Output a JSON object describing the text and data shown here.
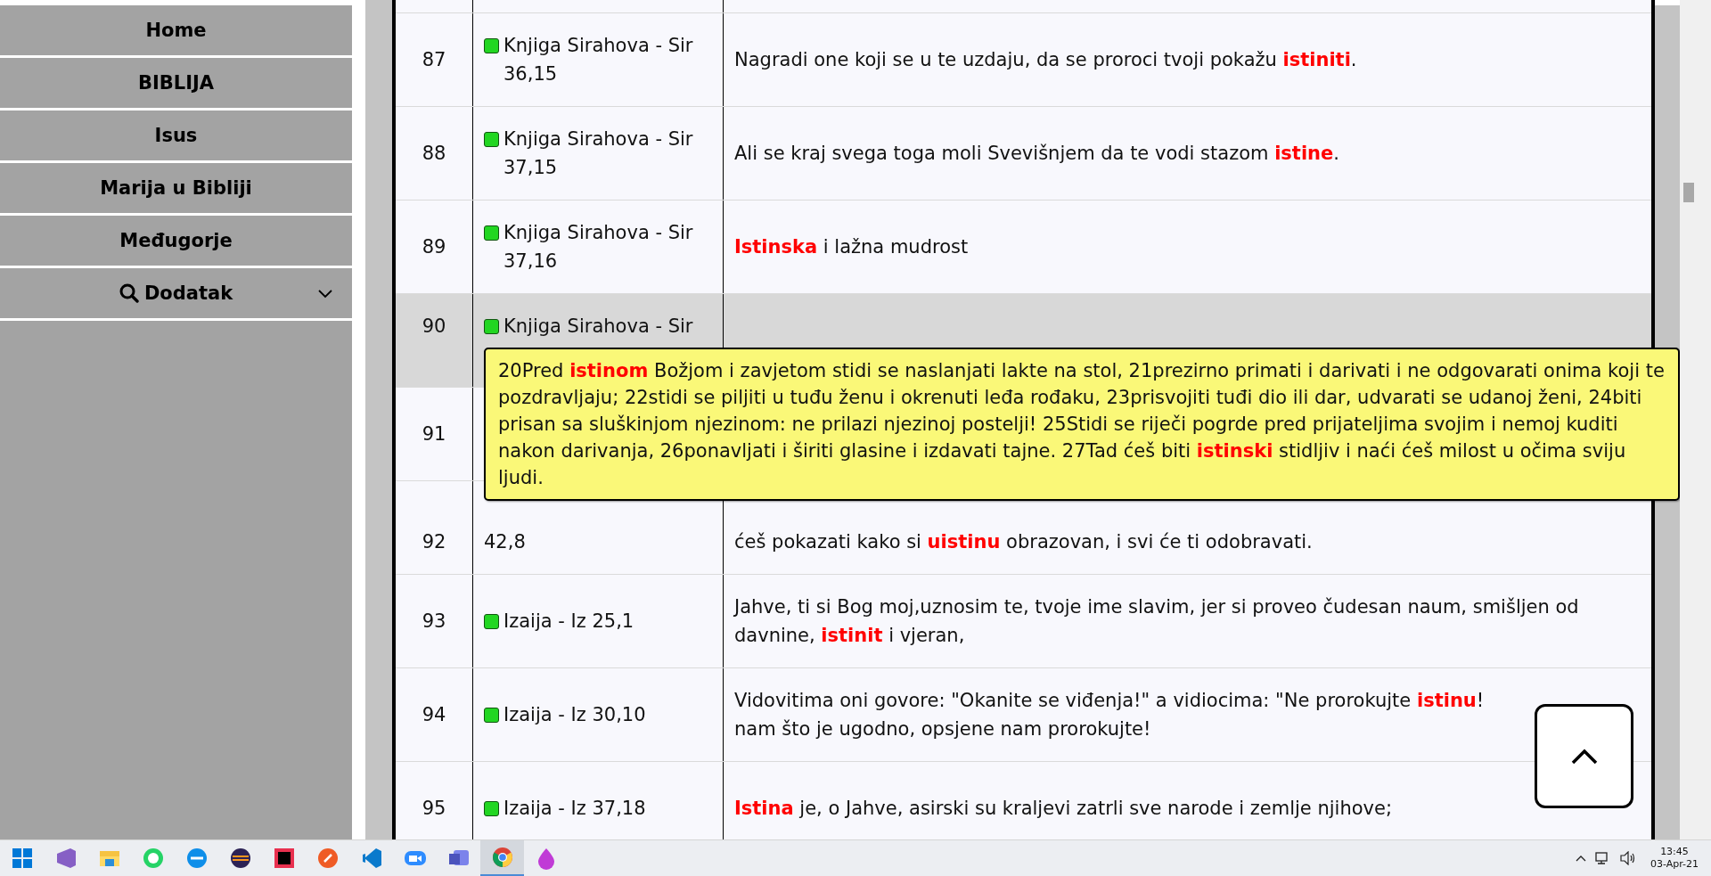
{
  "sidebar": {
    "items": [
      {
        "label": "Home",
        "kind": "link"
      },
      {
        "label": "BIBLIJA",
        "kind": "link"
      },
      {
        "label": "Isus",
        "kind": "link"
      },
      {
        "label": "Marija u Bibliji",
        "kind": "link"
      },
      {
        "label": "Međugorje",
        "kind": "link"
      },
      {
        "label": "Dodatak",
        "kind": "dropdown",
        "expanded": false
      }
    ]
  },
  "table": {
    "rows": [
      {
        "number": "87",
        "reference": "Knjiga Sirahova - Sir 36,15",
        "text": "Nagradi one koji se u te uzdaju, da se proroci tvoji pokažu **istiniti**.",
        "highlighted": false,
        "top_hidden": false
      },
      {
        "number": "88",
        "reference": "Knjiga Sirahova - Sir 37,15",
        "text": "Ali se kraj svega toga moli Svevišnjem da te vodi stazom **istine**.",
        "highlighted": false,
        "top_hidden": false
      },
      {
        "number": "89",
        "reference": "Knjiga Sirahova - Sir 37,16",
        "text": "**Istinska** i lažna mudrost",
        "highlighted": false,
        "top_hidden": false
      },
      {
        "number": "90",
        "reference": "Knjiga Sirahova - Sir",
        "highlighted": true,
        "top_hidden": false,
        "bottom_hidden": true
      },
      {
        "number": "91",
        "highlighted": false,
        "top_hidden": false
      },
      {
        "number": "92",
        "reference": "42,8",
        "text": "ćeš pokazati kako si **uistinu** obrazovan, i svi će ti odobravati.",
        "highlighted": false,
        "top_hidden": true
      },
      {
        "number": "93",
        "reference": "Izaija - Iz 25,1",
        "text": "Jahve, ti si Bog moj,uznosim te, tvoje ime slavim, jer si proveo čudesan naum, smišljen od davnine, **istinit** i vjeran,",
        "highlighted": false,
        "top_hidden": false
      },
      {
        "number": "94",
        "reference": "Izaija - Iz 30,10",
        "text": "Vidovitima oni govore: \"Okanite se viđenja!\" a vidiocima: \"Ne prorokujte **istinu**!\nnam što je ugodno, opsjene nam prorokujte!",
        "highlighted": false,
        "top_hidden": false
      },
      {
        "number": "95",
        "reference": "Izaija - Iz 37,18",
        "text": "**Istina** je, o Jahve, asirski su kraljevi zatrli sve narode i zemlje njihove;",
        "highlighted": false,
        "top_hidden": false
      }
    ]
  },
  "tooltip": {
    "text": "20Pred **istinom** Božjom i zavjetom stidi se naslanjati lakte na stol, 21prezirno primati i darivati i ne odgovarati onima koji te pozdravljaju; 22stidi se piljiti u tuđu ženu i okrenuti leđa rođaku, 23prisvojiti tuđi dio ili dar, udvarati se udanoj ženi, 24biti prisan sa sluškinjom njezinom: ne prilazi njezinoj postelji! 25Stidi se riječi pogrde pred prijateljima svojim i nemoj kuditi nakon darivanja, 26ponavljati i širiti glasine i izdavati tajne. 27Tad ćeš biti **istinski** stidljiv i naći ćeš milost u očima sviju ljudi."
  },
  "taskbar": {
    "apps": [
      {
        "kind": "start",
        "active": false
      },
      {
        "kind": "studio",
        "active": false
      },
      {
        "kind": "folder",
        "active": false
      },
      {
        "kind": "chat",
        "active": false
      },
      {
        "kind": "remote",
        "active": false
      },
      {
        "kind": "eclipse",
        "active": false
      },
      {
        "kind": "ide",
        "active": false
      },
      {
        "kind": "rocket",
        "active": false
      },
      {
        "kind": "code",
        "active": false
      },
      {
        "kind": "camera",
        "active": false
      },
      {
        "kind": "teams",
        "active": false
      },
      {
        "kind": "browser",
        "active": true
      },
      {
        "kind": "drop",
        "active": false
      }
    ],
    "time": "13:45",
    "date": "03-Apr-21"
  }
}
